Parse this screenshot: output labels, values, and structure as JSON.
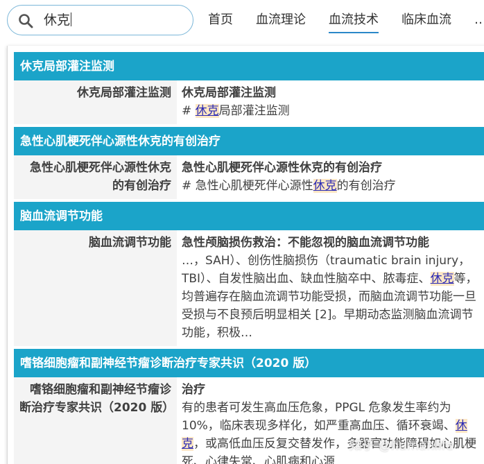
{
  "search": {
    "query": "休克"
  },
  "nav": {
    "items": [
      "首页",
      "血流理论",
      "血流技术",
      "临床血流",
      "…"
    ],
    "active": "血流技术"
  },
  "groups": [
    {
      "title": "休克局部灌注监测",
      "label": "休克局部灌注监测",
      "content_title": "休克局部灌注监测",
      "snippet_prefix": "# ",
      "snippet_highlight": "休克",
      "snippet_suffix": "局部灌注监测"
    },
    {
      "title": "急性心肌梗死伴心源性休克的有创治疗",
      "label": "急性心肌梗死伴心源性休克的有创治疗",
      "content_title": "急性心肌梗死伴心源性休克的有创治疗",
      "snippet_prefix": "# 急性心肌梗死伴心源性",
      "snippet_highlight": "休克",
      "snippet_suffix": "的有创治疗"
    },
    {
      "title": "脑血流调节功能",
      "label": "脑血流调节功能",
      "content_title": "急性颅脑损伤救治：不能忽视的脑血流调节功能",
      "snippet_prefix": "…，SAH）、创伤性脑损伤（traumatic brain injury，TBI）、自发性脑出血、缺血性脑卒中、脓毒症、",
      "snippet_highlight": "休克",
      "snippet_suffix": "等，均普遍存在脑血流调节功能受损，而脑血流调节功能一旦受损与不良预后明显相关 [2]。早期动态监测脑血流调节功能，积极…"
    },
    {
      "title": "嗜铬细胞瘤和副神经节瘤诊断治疗专家共识（2020 版）",
      "label": "嗜铬细胞瘤和副神经节瘤诊断治疗专家共识（2020 版）",
      "content_title": "治疗",
      "snippet_prefix": "有的患者可发生高血压危象，PPGL 危象发生率约为 10%，临床表现多样化，如严重高血压、循环衰竭、",
      "snippet_highlight": "休克",
      "snippet_suffix": "，或高低血压反复交替发作，多器官功能障碍如心肌梗死、心律失常、心肌病和心源"
    }
  ],
  "watermark": "知乎 @humanlife",
  "colors": {
    "group_header": "#1ba4c9",
    "highlight_bg": "#fde6c4",
    "highlight_text": "#2b2bb5",
    "nav_active": "#2a88c9"
  }
}
